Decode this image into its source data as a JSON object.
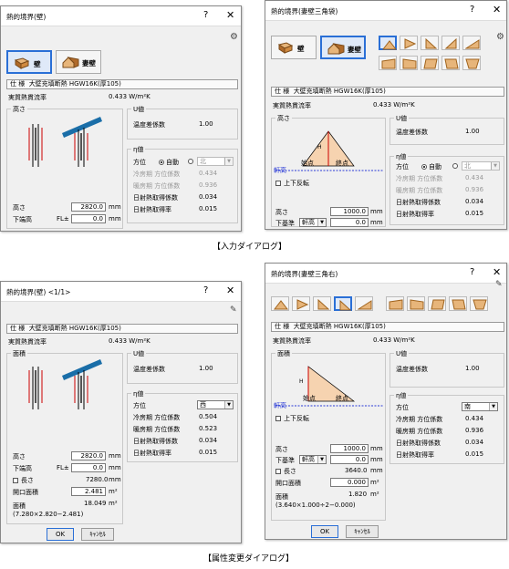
{
  "captions": {
    "input": "【入力ダイアログ】",
    "attr": "【属性変更ダイアログ】"
  },
  "common": {
    "help": "?",
    "close": "✕",
    "wall_label": "壁",
    "gable_label": "妻壁",
    "spec_label": "仕 様",
    "spec_value": "大壁充填断熱 HGW16K(厚105)",
    "heat_flow_label": "実質熱貫流率",
    "heat_flow_value": "0.433 W/m²K",
    "u_group": "U値",
    "temp_diff_label": "温度差係数",
    "temp_diff_value": "1.00",
    "eta_group": "η値",
    "azimuth_label": "方位",
    "auto_label": "自動",
    "cool_label": "冷房期 方位係数",
    "warm_label": "暖房期 方位係数",
    "solar_acq_label": "日射熱取得係数",
    "solar_acq_value": "0.034",
    "solar_rate_label": "日射熱取得率",
    "solar_rate_value": "0.015",
    "height_label": "高さ",
    "height_group": "高さ",
    "area_group": "面積",
    "down_label": "下端高",
    "fl_label": "FL±",
    "mm": "mm",
    "reverse_label": "上下反転",
    "eaves_label": "軒高",
    "pointA": "始点",
    "pointB": "終点",
    "H": "H",
    "base_label": "下基準",
    "base_value": "軒高",
    "m2": "m²",
    "ok": "OK",
    "cancel": "ｷｬﾝｾﾙ",
    "length_label": "長さ",
    "opening_label": "開口面積"
  },
  "d1": {
    "title": "熱的境界(壁)",
    "az_value": "北",
    "cool_value": "0.434",
    "warm_value": "0.936",
    "height": "2820.0",
    "down": "0.0"
  },
  "d2": {
    "title": "熱的境界(妻壁三角袋)",
    "az_value": "北",
    "cool_value": "0.434",
    "warm_value": "0.936",
    "height": "1000.0",
    "down": "0.0"
  },
  "d3": {
    "title": "熱的境界(壁)",
    "page": "<1/1>",
    "az_value": "西",
    "cool_value": "0.504",
    "warm_value": "0.523",
    "height": "2820.0",
    "down": "0.0",
    "length": "7280.0",
    "opening": "2.481",
    "area": "18.049",
    "formula": "(7.280×2.820−2.481)"
  },
  "d4": {
    "title": "熱的境界(妻壁三角右)",
    "az_value": "南",
    "cool_value": "0.434",
    "warm_value": "0.936",
    "height": "1000.0",
    "down": "0.0",
    "length": "3640.0",
    "opening": "0.000",
    "area": "1.820",
    "formula": "(3.640×1.000÷2−0.000)"
  }
}
